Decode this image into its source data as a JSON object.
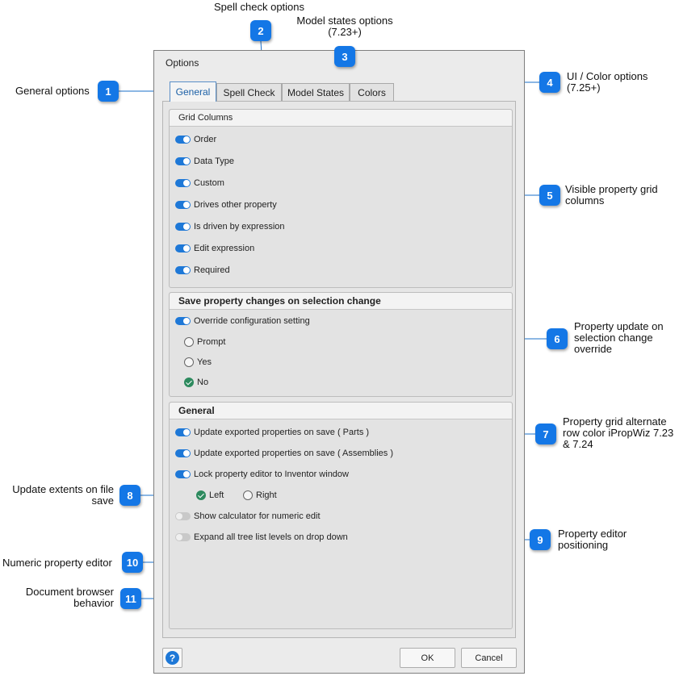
{
  "dialog": {
    "title": "Options",
    "tabs": [
      {
        "label": "General",
        "active": true
      },
      {
        "label": "Spell Check",
        "active": false
      },
      {
        "label": "Model States",
        "active": false
      },
      {
        "label": "Colors",
        "active": false
      }
    ],
    "grid_columns": {
      "header": "Grid Columns",
      "items": [
        {
          "label": "Order",
          "on": true
        },
        {
          "label": "Data Type",
          "on": true
        },
        {
          "label": "Custom",
          "on": true
        },
        {
          "label": "Drives other property",
          "on": true
        },
        {
          "label": "Is driven by expression",
          "on": true
        },
        {
          "label": "Edit expression",
          "on": true
        },
        {
          "label": "Required",
          "on": true
        }
      ]
    },
    "save_changes": {
      "header": "Save property changes on selection change",
      "override_label": "Override configuration setting",
      "override_on": true,
      "options": [
        {
          "label": "Prompt",
          "selected": false
        },
        {
          "label": "Yes",
          "selected": false
        },
        {
          "label": "No",
          "selected": true
        }
      ]
    },
    "general": {
      "header": "General",
      "update_parts": "Update exported properties on save ( Parts )",
      "update_assemblies": "Update exported properties on save ( Assemblies )",
      "lock_editor": "Lock property editor to Inventor window",
      "side_left": "Left",
      "side_right": "Right",
      "side_selected": "Left",
      "show_calculator": "Show calculator for numeric edit",
      "expand_tree": "Expand all tree list levels on drop down"
    },
    "buttons": {
      "ok": "OK",
      "cancel": "Cancel",
      "help": "?"
    }
  },
  "callouts": [
    {
      "n": "1",
      "label": "General options"
    },
    {
      "n": "2",
      "label": "Spell check options"
    },
    {
      "n": "3",
      "label_l1": "Model states options",
      "label_l2": "(7.23+)"
    },
    {
      "n": "4",
      "label_l1": "UI / Color options",
      "label_l2": "(7.25+)"
    },
    {
      "n": "5",
      "label_l1": "Visible property grid",
      "label_l2": "columns"
    },
    {
      "n": "6",
      "label_l1": "Property update on",
      "label_l2": "selection change",
      "label_l3": "override"
    },
    {
      "n": "7",
      "label_l1": "Property grid alternate",
      "label_l2": "row color iPropWiz 7.23",
      "label_l3": "& 7.24"
    },
    {
      "n": "8",
      "label_l1": "Update extents on file",
      "label_l2": "save"
    },
    {
      "n": "9",
      "label_l1": "Property editor",
      "label_l2": "positioning"
    },
    {
      "n": "10",
      "label": "Numeric property editor"
    },
    {
      "n": "11",
      "label_l1": "Document browser",
      "label_l2": "behavior"
    }
  ],
  "colors": {
    "accent": "#1e78d7",
    "callout": "#1477e6",
    "radio_selected": "#2d8a5e"
  }
}
